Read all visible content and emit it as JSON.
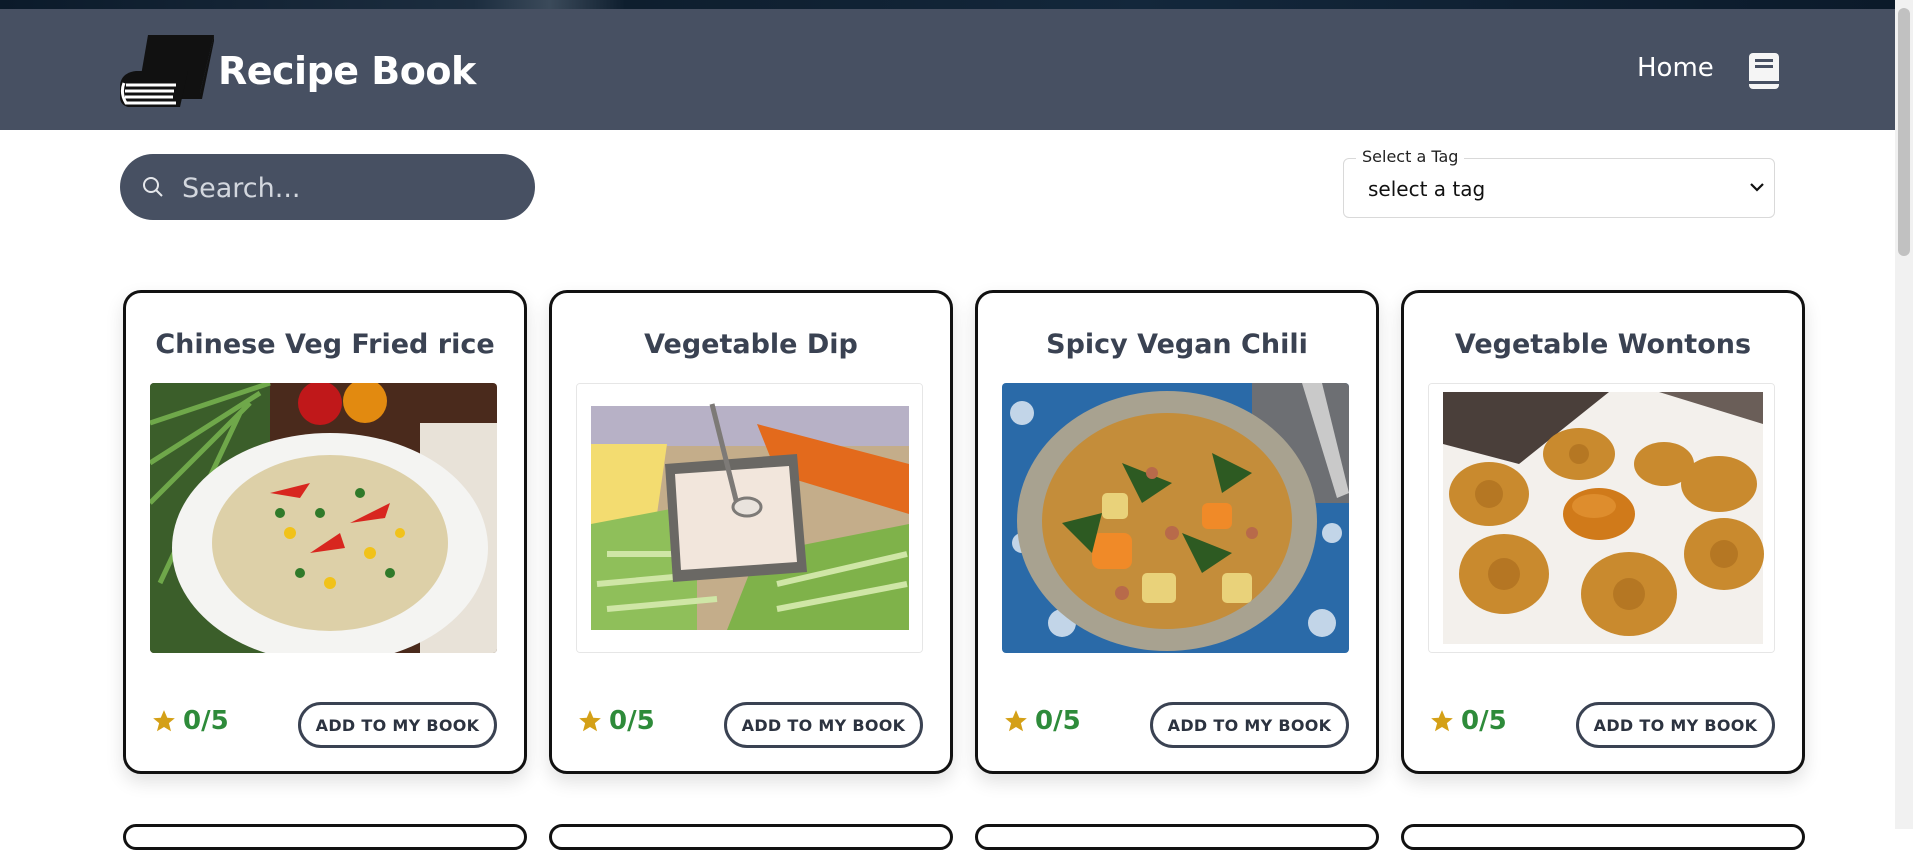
{
  "navbar": {
    "brand_title": "Recipe Book",
    "home_label": "Home",
    "logo_icon": "book-logo-icon",
    "book_icon": "book-icon"
  },
  "search": {
    "placeholder": "Search...",
    "value": "",
    "icon": "search-icon"
  },
  "tag_select": {
    "label": "Select a Tag",
    "selected": "select a tag",
    "icon": "chevron-down-icon"
  },
  "recipes": [
    {
      "title": "Chinese Veg Fried rice",
      "rating": "0/5",
      "button": "ADD TO MY BOOK"
    },
    {
      "title": "Vegetable Dip",
      "rating": "0/5",
      "button": "ADD TO MY BOOK"
    },
    {
      "title": "Spicy Vegan Chili",
      "rating": "0/5",
      "button": "ADD TO MY BOOK"
    },
    {
      "title": "Vegetable Wontons",
      "rating": "0/5",
      "button": "ADD TO MY BOOK"
    }
  ],
  "colors": {
    "navbar": "#475062",
    "rating": "#2e8b3a",
    "star": "#d4a017",
    "card_border": "#111111"
  }
}
